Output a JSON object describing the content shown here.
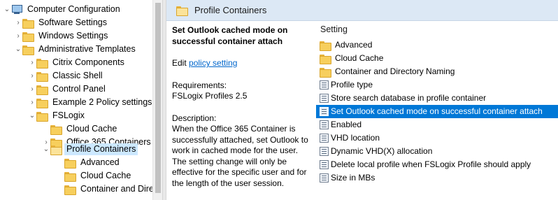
{
  "tree": {
    "items": [
      {
        "label": "Computer Configuration",
        "chevron": "⌄",
        "icon": "computer-icon"
      },
      {
        "label": "Software Settings",
        "chevron": "›",
        "icon": "folder-icon"
      },
      {
        "label": "Windows Settings",
        "chevron": "›",
        "icon": "folder-icon"
      },
      {
        "label": "Administrative Templates",
        "chevron": "⌄",
        "icon": "folder-icon"
      },
      {
        "label": "Citrix Components",
        "chevron": "›",
        "icon": "folder-icon"
      },
      {
        "label": "Classic Shell",
        "chevron": "›",
        "icon": "folder-icon"
      },
      {
        "label": "Control Panel",
        "chevron": "›",
        "icon": "folder-icon"
      },
      {
        "label": "Example 2 Policy settings",
        "chevron": "›",
        "icon": "folder-icon"
      },
      {
        "label": "FSLogix",
        "chevron": "⌄",
        "icon": "folder-icon"
      },
      {
        "label": "Cloud Cache",
        "chevron": "",
        "icon": "folder-icon"
      },
      {
        "label": "Office 365 Containers",
        "chevron": "›",
        "icon": "folder-icon"
      },
      {
        "label": "Profile Containers",
        "chevron": "⌄",
        "icon": "folder-open-icon",
        "selected": true
      },
      {
        "label": "Advanced",
        "chevron": "",
        "icon": "folder-icon"
      },
      {
        "label": "Cloud Cache",
        "chevron": "",
        "icon": "folder-icon"
      },
      {
        "label": "Container and Dire",
        "chevron": "",
        "icon": "folder-icon"
      }
    ]
  },
  "panel": {
    "title": "Profile Containers"
  },
  "description": {
    "title": "Set Outlook cached mode on successful container attach",
    "edit_prefix": "Edit ",
    "edit_link": "policy setting",
    "requirements_label": "Requirements:",
    "requirements_value": "FSLogix Profiles 2.5",
    "description_label": "Description:",
    "description_text": "When the Office 365 Container is successfully attached, set Outlook to work in cached mode for the user. The setting change will only be effective for the specific user and for the length of the user session."
  },
  "settings": {
    "column_header": "Setting",
    "items": [
      {
        "label": "Advanced",
        "icon": "folder-icon"
      },
      {
        "label": "Cloud Cache",
        "icon": "folder-icon"
      },
      {
        "label": "Container and Directory Naming",
        "icon": "folder-icon"
      },
      {
        "label": "Profile type",
        "icon": "policy-icon"
      },
      {
        "label": "Store search database in profile container",
        "icon": "policy-icon"
      },
      {
        "label": "Set Outlook cached mode on successful container attach",
        "icon": "policy-icon",
        "selected": true
      },
      {
        "label": "Enabled",
        "icon": "policy-icon"
      },
      {
        "label": "VHD location",
        "icon": "policy-icon"
      },
      {
        "label": "Dynamic VHD(X) allocation",
        "icon": "policy-icon"
      },
      {
        "label": "Delete local profile when FSLogix Profile should apply",
        "icon": "policy-icon"
      },
      {
        "label": "Size in MBs",
        "icon": "policy-icon"
      }
    ]
  },
  "colors": {
    "selection": "#0078d7",
    "tree_selection": "#cce8ff",
    "header_bg": "#dce8f5",
    "link": "#0066cc"
  }
}
